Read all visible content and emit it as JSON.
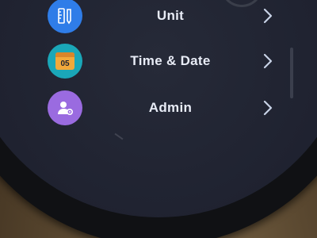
{
  "menu": {
    "items": [
      {
        "label": "Unit",
        "icon": "ruler-pencil-icon",
        "color": "#2f7de8"
      },
      {
        "label": "Time & Date",
        "icon": "calendar-icon",
        "color": "#f2a93b",
        "calendar_day": "05"
      },
      {
        "label": "Admin",
        "icon": "user-settings-icon",
        "color": "#9a6be0"
      }
    ]
  },
  "colors": {
    "screen_bg": "#1f2230",
    "label_text": "#e8ecf6",
    "chevron": "#c8d2e6"
  }
}
